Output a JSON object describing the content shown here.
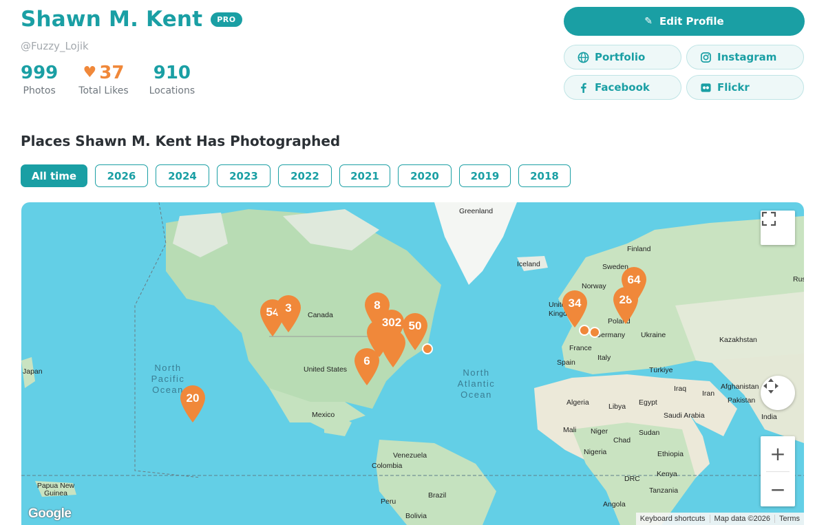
{
  "profile": {
    "name": "Shawn M. Kent",
    "badge": "PRO",
    "handle": "@Fuzzy_Lojik",
    "stats": [
      {
        "value": "999",
        "label": "Photos"
      },
      {
        "value": "37",
        "label": "Total Likes"
      },
      {
        "value": "910",
        "label": "Locations"
      }
    ]
  },
  "actions": {
    "edit_profile": "Edit Profile",
    "links": [
      {
        "label": "Portfolio",
        "icon": "globe-icon"
      },
      {
        "label": "Instagram",
        "icon": "instagram-icon"
      },
      {
        "label": "Facebook",
        "icon": "facebook-icon"
      },
      {
        "label": "Flickr",
        "icon": "flickr-icon"
      }
    ]
  },
  "section_title": "Places Shawn M. Kent Has Photographed",
  "year_filters": [
    "All time",
    "2026",
    "2024",
    "2023",
    "2022",
    "2021",
    "2020",
    "2019",
    "2018"
  ],
  "active_filter": "All time",
  "map": {
    "labels": [
      "Greenland",
      "Finland",
      "Iceland",
      "Sweden",
      "Norway",
      "Rus",
      "Canada",
      "United Kingdom",
      "Poland",
      "Germany",
      "Ukraine",
      "Kazakhstan",
      "France",
      "Italy",
      "Spain",
      "Türkiye",
      "Japan",
      "United States",
      "Iraq",
      "Iran",
      "Afghanistan",
      "Pakistan",
      "Mexico",
      "Algeria",
      "Libya",
      "Egypt",
      "Saudi Arabia",
      "India",
      "Mali",
      "Niger",
      "Sudan",
      "Chad",
      "Nigeria",
      "Ethiopia",
      "Venezuela",
      "Colombia",
      "DRC",
      "Kenya",
      "Papua New Guinea",
      "Tanzania",
      "Peru",
      "Brazil",
      "Bolivia",
      "Angola"
    ],
    "oceans": [
      "North Pacific Ocean",
      "North Atlantic Ocean"
    ],
    "clusters": [
      "54",
      "3",
      "8",
      "302",
      "50",
      "6",
      "20",
      "34",
      "28",
      "64"
    ],
    "attribution": [
      "Keyboard shortcuts",
      "Map data ©2026",
      "Terms"
    ],
    "logo": "Google",
    "marker_color": "#f0883a",
    "accent": "#1a9fa4"
  }
}
